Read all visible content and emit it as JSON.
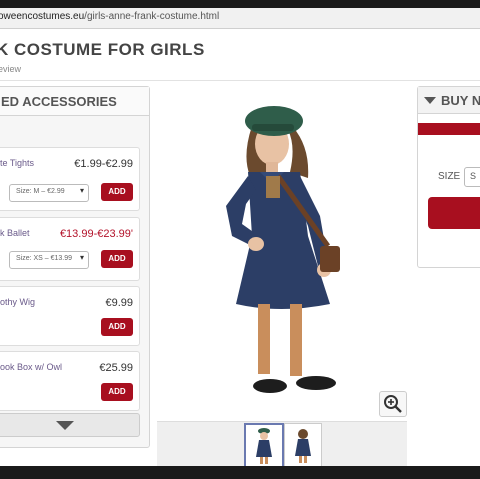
{
  "browser": {
    "url_host": "oweencostumes.eu",
    "url_path": "/girls-anne-frank-costume.html"
  },
  "page": {
    "title": "K COSTUME FOR GIRLS",
    "subreview": "eview"
  },
  "accessories": {
    "header": "ED ACCESSORIES",
    "items": [
      {
        "name": "te Tights",
        "price": "€1.99-€2.99",
        "size": "Size: M – €2.99",
        "add": "ADD"
      },
      {
        "name": "k Ballet",
        "price": "€13.99-€23.99'",
        "size": "Size: XS – €13.99",
        "add": "ADD"
      },
      {
        "name": "othy Wig",
        "price": "€9.99",
        "add": "ADD"
      },
      {
        "name": "ook Box w/ Owl",
        "price": "€25.99",
        "add": "ADD"
      }
    ]
  },
  "buy": {
    "header": "BUY N",
    "size_label": "SIZE",
    "size_value": "S"
  },
  "colors": {
    "accent_red": "#a80f1f",
    "sale_red": "#b3122a"
  },
  "icons": {
    "zoom": "magnifier-plus-icon",
    "more": "chevron-down-icon",
    "caret": "select-caret-icon"
  }
}
